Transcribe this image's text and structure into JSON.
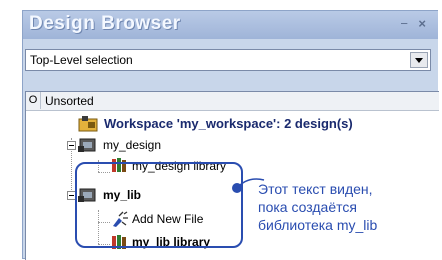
{
  "window": {
    "title": "Design Browser",
    "minimize_icon": "pin-icon",
    "close_icon": "close-icon"
  },
  "selector": {
    "value": "Top-Level selection"
  },
  "tree": {
    "header": {
      "column_marker": "O",
      "label": "Unsorted"
    },
    "workspace": "Workspace 'my_workspace': 2 design(s)",
    "items": [
      {
        "label": "my_design",
        "icon": "design-icon"
      },
      {
        "label": "my_design library",
        "icon": "library-icon"
      },
      {
        "label": "my_lib",
        "icon": "design-icon"
      },
      {
        "label": "Add New File",
        "icon": "add-file-icon"
      },
      {
        "label": "my_lib library",
        "icon": "library-icon"
      }
    ]
  },
  "annotation": {
    "lines": [
      "Этот текст виден,",
      "пока создаётся",
      "библиотека my_lib"
    ],
    "color": "#2a4db0"
  }
}
